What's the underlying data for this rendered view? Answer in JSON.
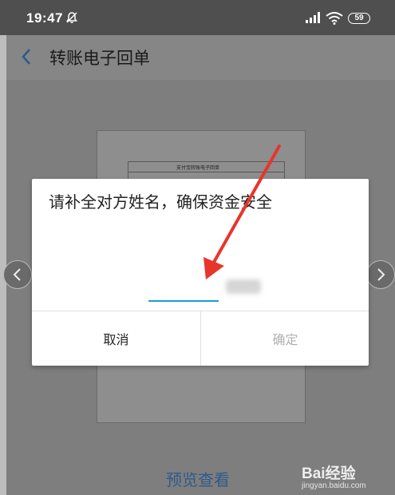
{
  "status_bar": {
    "time": "19:47",
    "battery": "59",
    "icons": [
      "bell-off-icon",
      "signal-icon",
      "wifi-icon",
      "battery-icon"
    ]
  },
  "app_bar": {
    "title": "转账电子回单",
    "back_icon": "chevron-left-icon"
  },
  "receipt_preview": {
    "title": "支付宝转账电子回单"
  },
  "dialog": {
    "title": "请补全对方姓名，确保资金安全",
    "input_value": "",
    "cancel_label": "取消",
    "confirm_label": "确定"
  },
  "page": {
    "preview_link": "预览查看"
  },
  "watermark": {
    "logo": "Bai经验",
    "url": "jingyan.baidu.com"
  },
  "colors": {
    "status_bar": "#4f4f4f",
    "input_accent": "#1a9fd0",
    "arrow": "#e8352b",
    "disabled_text": "#b0b0b0",
    "link": "#2f5b8a"
  }
}
